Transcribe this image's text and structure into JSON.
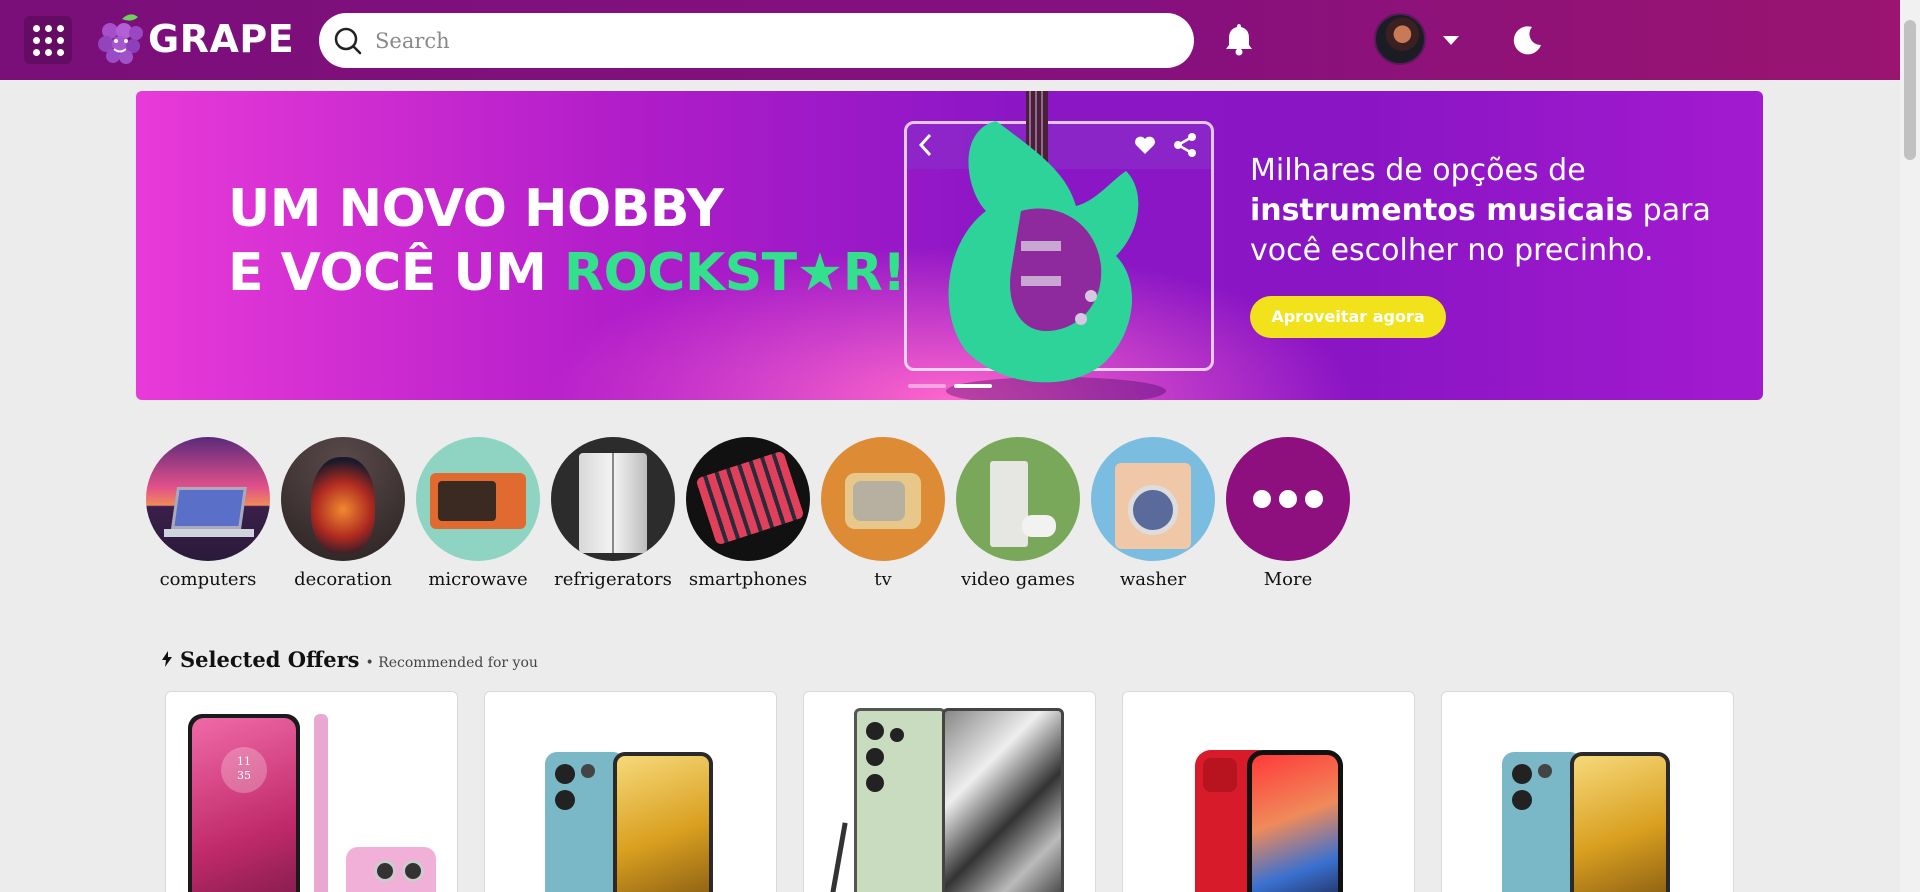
{
  "header": {
    "apps_icon": "apps-grid-icon",
    "logo_text": "GRAPE",
    "search_placeholder": "Search",
    "notifications_icon": "bell-icon",
    "theme_icon": "moon-icon"
  },
  "banner": {
    "headline_line1": "UM NOVO HOBBY",
    "headline_line2_prefix": "E VOCÊ UM ",
    "headline_line2_accent": "ROCKST★R!",
    "sub_line1": "Milhares de opções de",
    "sub_bold": "instrumentos musicais",
    "sub_after_bold": " para",
    "sub_line3": "você escolher no precinho.",
    "cta_label": "Aproveitar agora",
    "slides_total": 2,
    "active_slide": 2
  },
  "categories": [
    {
      "label": "computers",
      "icon": "laptop-image"
    },
    {
      "label": "decoration",
      "icon": "vase-image"
    },
    {
      "label": "microwave",
      "icon": "microwave-image"
    },
    {
      "label": "refrigerators",
      "icon": "fridge-image"
    },
    {
      "label": "smartphones",
      "icon": "smartphone-image"
    },
    {
      "label": "tv",
      "icon": "tv-image"
    },
    {
      "label": "video games",
      "icon": "console-image"
    },
    {
      "label": "washer",
      "icon": "washer-image"
    },
    {
      "label": "More",
      "icon": "more-dots-icon"
    }
  ],
  "offers": {
    "title": "Selected Offers",
    "subtitle": "• Recommended for you",
    "products": [
      {
        "name": "pink-smartphone",
        "clock_hour": "11",
        "clock_min": "35"
      },
      {
        "name": "teal-smartphone"
      },
      {
        "name": "green-smartphone-with-stylus"
      },
      {
        "name": "red-smartphone"
      },
      {
        "name": "teal-smartphone"
      }
    ]
  },
  "colors": {
    "header": "#86107e",
    "banner_start": "#e83ad8",
    "banner_end": "#8a16c6",
    "accent_green": "#33e08c",
    "cta": "#f1e21b",
    "more_circle": "#8e0f7e"
  }
}
